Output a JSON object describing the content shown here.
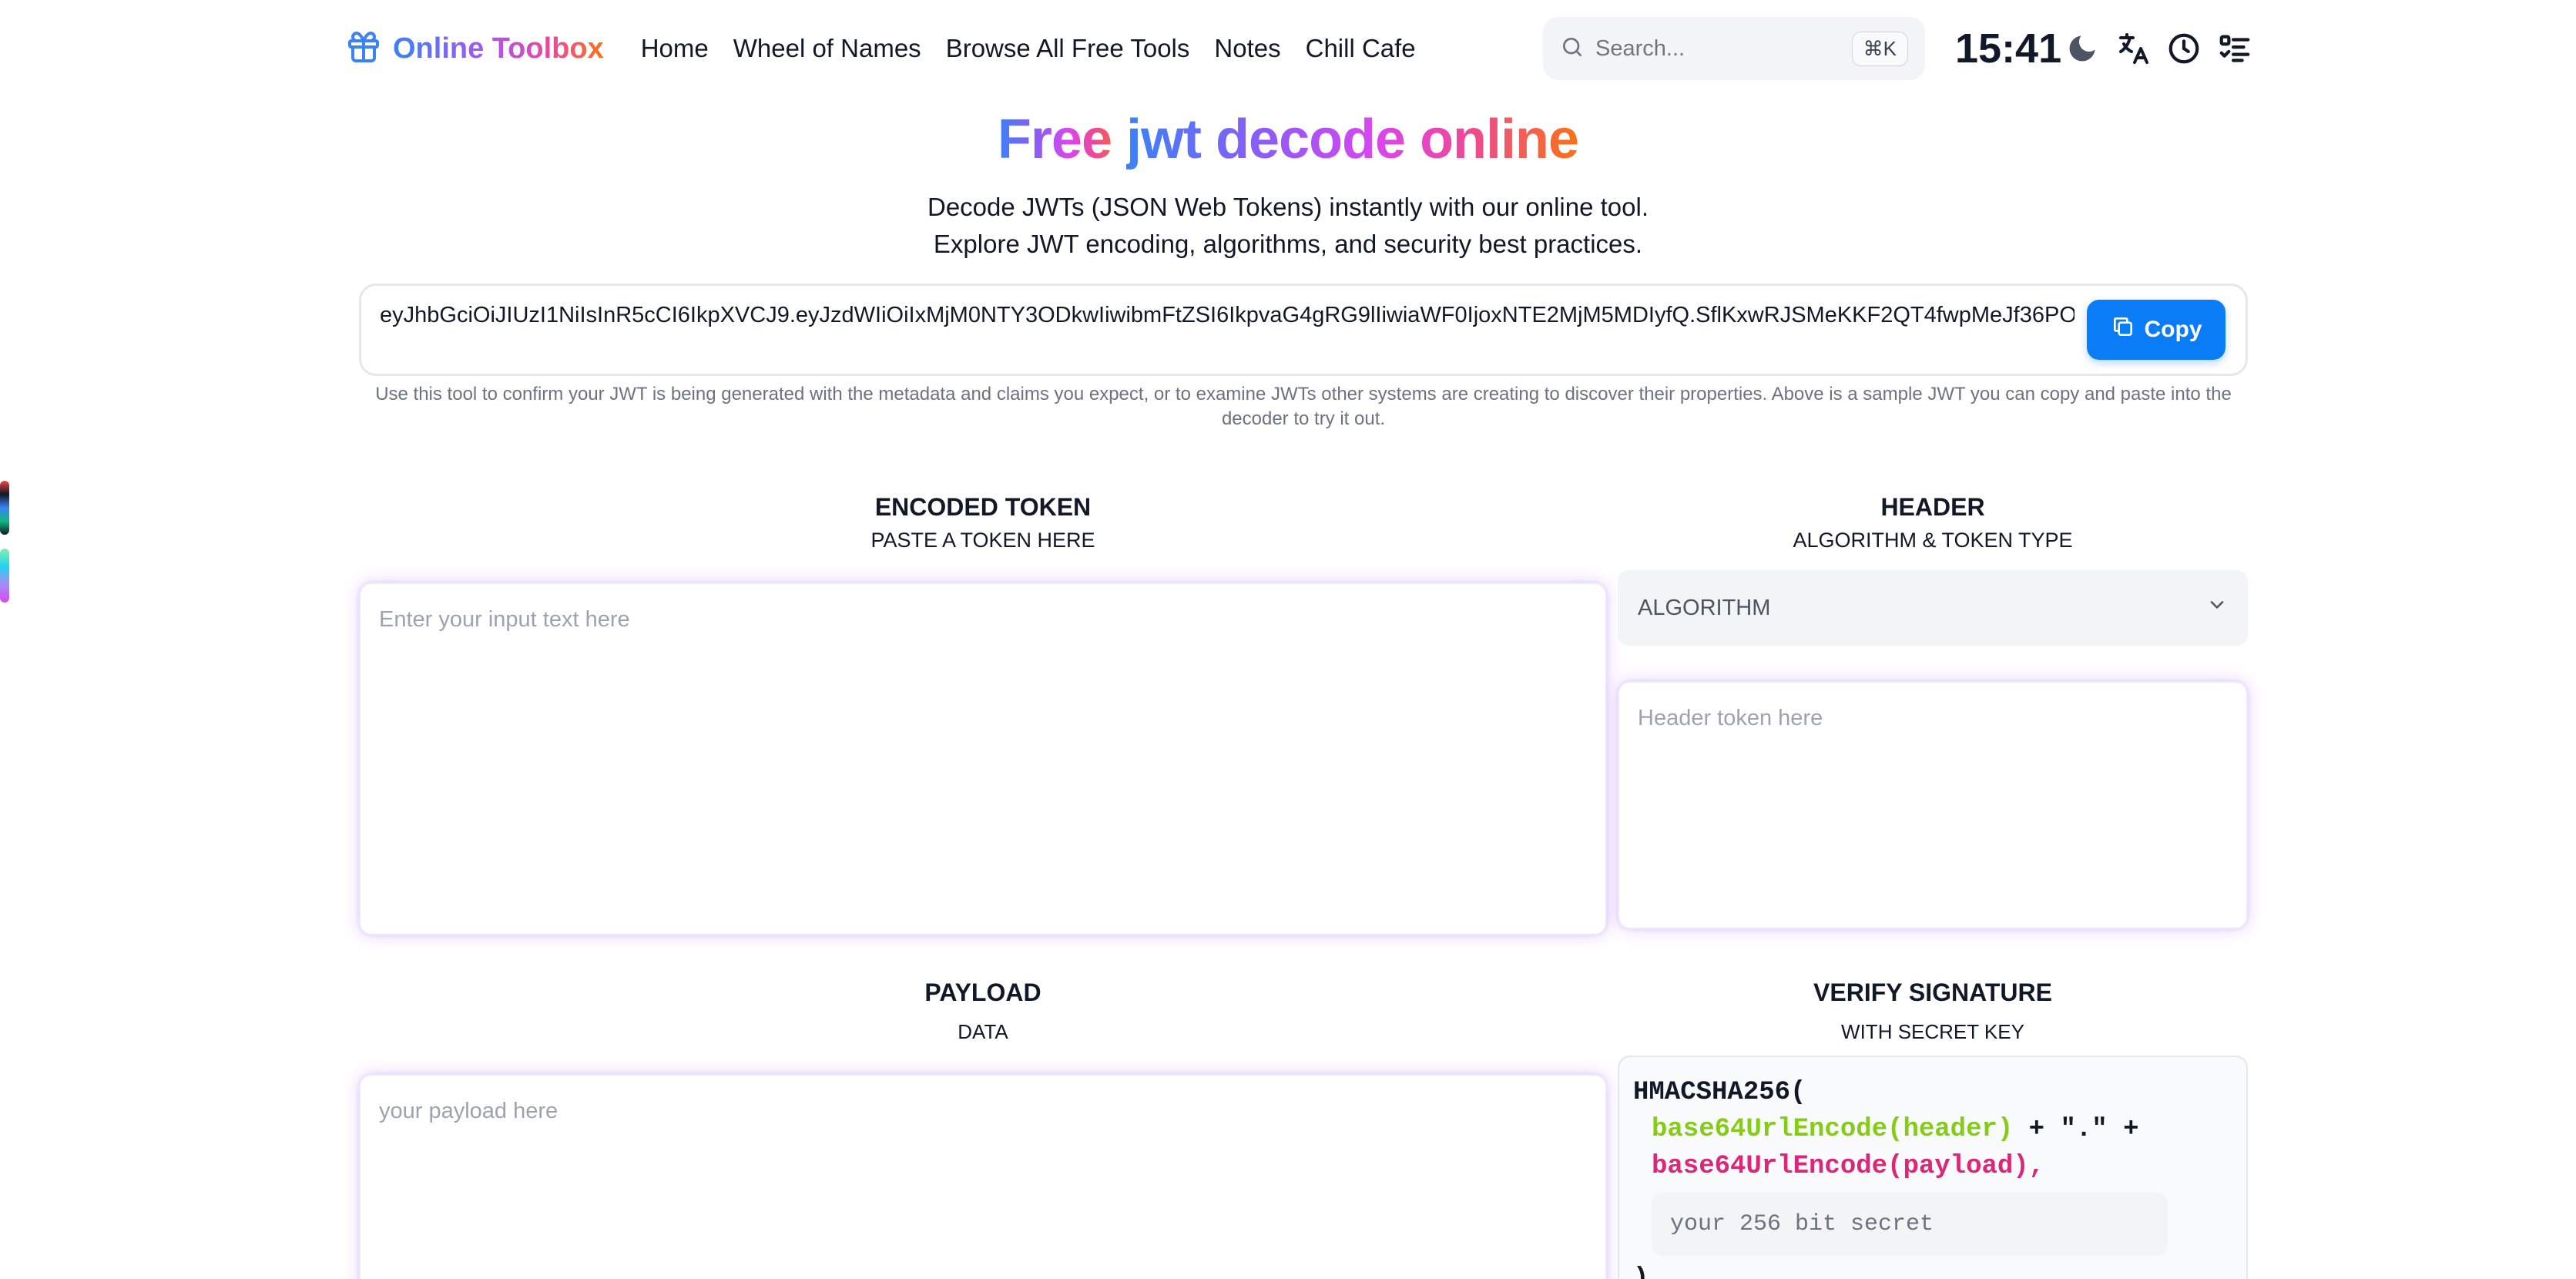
{
  "header": {
    "logo_text": "Online Toolbox",
    "nav": [
      "Home",
      "Wheel of Names",
      "Browse All Free Tools",
      "Notes",
      "Chill Cafe"
    ],
    "search_placeholder": "Search...",
    "search_shortcut": "⌘K",
    "clock": "15:41",
    "icons": [
      "gift-icon",
      "search-icon",
      "moon-icon",
      "translate-icon",
      "clock-icon",
      "checklist-icon"
    ]
  },
  "hero": {
    "title_prefix": "Free ",
    "title_mid": "jwt decode online",
    "subtitle_line1": "Decode JWTs (JSON Web Tokens) instantly with our online tool.",
    "subtitle_line2": "Explore JWT encoding, algorithms, and security best practices."
  },
  "sample": {
    "token": "eyJhbGciOiJIUzI1NiIsInR5cCI6IkpXVCJ9.eyJzdWIiOiIxMjM0NTY3ODkwIiwibmFtZSI6IkpvaG4gRG9lIiwiaWF0IjoxNTE2MjM5MDIyfQ.SflKxwRJSMeKKF2QT4fwpMeJf36PO",
    "copy_label": "Copy",
    "hint": "Use this tool to confirm your JWT is being generated with the metadata and claims you expect, or to examine JWTs other systems are creating to discover their properties. Above is a sample JWT you can copy and paste into the decoder to try it out."
  },
  "encoded": {
    "title": "ENCODED TOKEN",
    "subtitle": "PASTE A TOKEN HERE",
    "placeholder": "Enter your input text here"
  },
  "header_section": {
    "title": "HEADER",
    "subtitle": "ALGORITHM & TOKEN TYPE",
    "algorithm_label": "ALGORITHM",
    "placeholder": "Header token here"
  },
  "payload": {
    "title": "PAYLOAD",
    "subtitle": "DATA",
    "placeholder": "your payload here"
  },
  "verify": {
    "title": "VERIFY SIGNATURE",
    "subtitle": "WITH SECRET KEY",
    "fn_open": "HMACSHA256(",
    "line_header": "base64UrlEncode(header)",
    "line_concat": " + \".\" +",
    "line_payload": "base64UrlEncode(payload),",
    "secret_placeholder": "your 256 bit secret",
    "fn_close": ")"
  },
  "colors": {
    "accent": "#0a7cf5",
    "header_fn": "#84cc16",
    "payload_fn": "#db2777"
  }
}
